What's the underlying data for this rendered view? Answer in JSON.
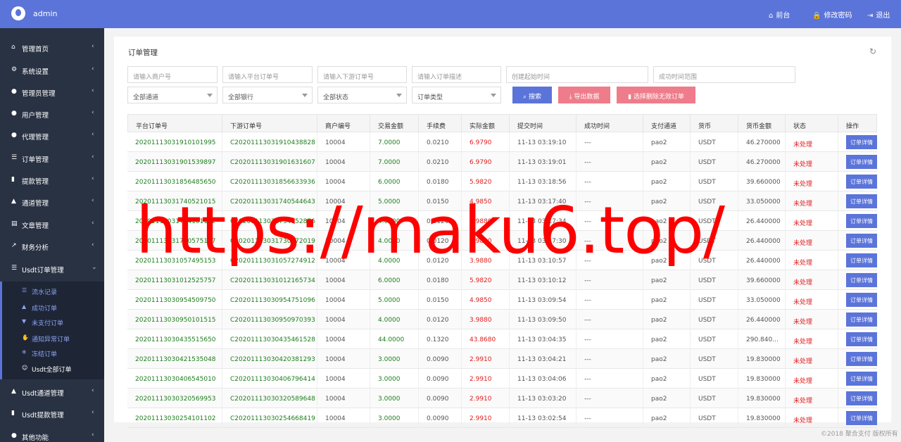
{
  "header": {
    "username": "admin",
    "links": [
      {
        "icon": "home-icon",
        "label": "前台"
      },
      {
        "icon": "lock-icon",
        "label": "修改密码"
      },
      {
        "icon": "logout-icon",
        "label": "退出"
      }
    ]
  },
  "sidebar": {
    "items": [
      {
        "icon": "home-icon",
        "label": "管理首页"
      },
      {
        "icon": "gears-icon",
        "label": "系统设置"
      },
      {
        "icon": "user-circle-icon",
        "label": "管理员管理"
      },
      {
        "icon": "users-icon",
        "label": "用户管理"
      },
      {
        "icon": "user-circle-icon",
        "label": "代理管理"
      },
      {
        "icon": "list-icon",
        "label": "订单管理"
      },
      {
        "icon": "lock-icon",
        "label": "提款管理"
      },
      {
        "icon": "bank-icon",
        "label": "通道管理"
      },
      {
        "icon": "file-icon",
        "label": "文章管理"
      },
      {
        "icon": "chart-icon",
        "label": "财务分析"
      },
      {
        "icon": "list-icon",
        "label": "Usdt订单管理"
      },
      {
        "icon": "bank-icon",
        "label": "Usdt通道管理"
      },
      {
        "icon": "lock-icon",
        "label": "Usdt提款管理"
      },
      {
        "icon": "user-circle-icon",
        "label": "其他功能"
      }
    ],
    "subitems": [
      {
        "icon": "list-icon",
        "label": "流水记录"
      },
      {
        "icon": "thumbs-up-icon",
        "label": "成功订单"
      },
      {
        "icon": "thumbs-down-icon",
        "label": "未支付订单"
      },
      {
        "icon": "hand-icon",
        "label": "通知异常订单"
      },
      {
        "icon": "snowflake-icon",
        "label": "冻结订单"
      },
      {
        "icon": "smile-icon",
        "label": "Usdt全部订单"
      }
    ]
  },
  "page": {
    "title": "订单管理",
    "filters": {
      "merchant_no": "请输入商户号",
      "platform_order": "请输入平台订单号",
      "downstream_order": "请输入下游订单号",
      "order_desc": "请输入订单描述",
      "create_time": "创建起始时间",
      "success_time": "成功时间范围",
      "channel": "全部通道",
      "bank": "全部银行",
      "status": "全部状态",
      "order_type": "订单类型"
    },
    "buttons": {
      "search": "搜索",
      "export": "导出数据",
      "delete_invalid": "选择删除无效订单"
    }
  },
  "table": {
    "headers": [
      "平台订单号",
      "下游订单号",
      "商户编号",
      "交易金额",
      "手续费",
      "实际金额",
      "提交时间",
      "成功时间",
      "支付通道",
      "货币",
      "货币金额",
      "状态",
      "操作"
    ],
    "op_label": "订单详情",
    "rows": [
      [
        "20201113031910101995",
        "C20201113031910438828",
        "10004",
        "7.0000",
        "0.0210",
        "6.9790",
        "11-13 03:19:10",
        "---",
        "pao2",
        "USDT",
        "46.270000",
        "未处理"
      ],
      [
        "20201113031901539897",
        "C20201113031901631607",
        "10004",
        "7.0000",
        "0.0210",
        "6.9790",
        "11-13 03:19:01",
        "---",
        "pao2",
        "USDT",
        "46.270000",
        "未处理"
      ],
      [
        "20201113031856485650",
        "C20201113031856633936",
        "10004",
        "6.0000",
        "0.0180",
        "5.9820",
        "11-13 03:18:56",
        "---",
        "pao2",
        "USDT",
        "39.660000",
        "未处理"
      ],
      [
        "20201113031740521015",
        "C20201113031740544643",
        "10004",
        "5.0000",
        "0.0150",
        "4.9850",
        "11-13 03:17:40",
        "---",
        "pao2",
        "USDT",
        "33.050000",
        "未处理"
      ],
      [
        "20201113031734101102",
        "C20201113031734752876",
        "10004",
        "4.0000",
        "0.0120",
        "3.9880",
        "11-13 03:17:34",
        "---",
        "pao2",
        "USDT",
        "26.440000",
        "未处理"
      ],
      [
        "20201113031730575157",
        "C20201113031730272019",
        "10004",
        "4.0000",
        "0.0120",
        "3.9880",
        "11-13 03:17:30",
        "---",
        "pao2",
        "USDT",
        "26.440000",
        "未处理"
      ],
      [
        "20201113031057495153",
        "C20201113031057274912",
        "10004",
        "4.0000",
        "0.0120",
        "3.9880",
        "11-13 03:10:57",
        "---",
        "pao2",
        "USDT",
        "26.440000",
        "未处理"
      ],
      [
        "20201113031012525757",
        "C20201113031012165734",
        "10004",
        "6.0000",
        "0.0180",
        "5.9820",
        "11-13 03:10:12",
        "---",
        "pao2",
        "USDT",
        "39.660000",
        "未处理"
      ],
      [
        "20201113030954509750",
        "C20201113030954751096",
        "10004",
        "5.0000",
        "0.0150",
        "4.9850",
        "11-13 03:09:54",
        "---",
        "pao2",
        "USDT",
        "33.050000",
        "未处理"
      ],
      [
        "20201113030950101515",
        "C20201113030950970393",
        "10004",
        "4.0000",
        "0.0120",
        "3.9880",
        "11-13 03:09:50",
        "---",
        "pao2",
        "USDT",
        "26.440000",
        "未处理"
      ],
      [
        "20201113030435515650",
        "C20201113030435461528",
        "10004",
        "44.0000",
        "0.1320",
        "43.8680",
        "11-13 03:04:35",
        "---",
        "pao2",
        "USDT",
        "290.840...",
        "未处理"
      ],
      [
        "20201113030421535048",
        "C20201113030420381293",
        "10004",
        "3.0000",
        "0.0090",
        "2.9910",
        "11-13 03:04:21",
        "---",
        "pao2",
        "USDT",
        "19.830000",
        "未处理"
      ],
      [
        "20201113030406545010",
        "C20201113030406796414",
        "10004",
        "3.0000",
        "0.0090",
        "2.9910",
        "11-13 03:04:06",
        "---",
        "pao2",
        "USDT",
        "19.830000",
        "未处理"
      ],
      [
        "20201113030320569953",
        "C20201113030320589648",
        "10004",
        "3.0000",
        "0.0090",
        "2.9910",
        "11-13 03:03:20",
        "---",
        "pao2",
        "USDT",
        "19.830000",
        "未处理"
      ],
      [
        "20201113030254101102",
        "C20201113030254668419",
        "10004",
        "3.0000",
        "0.0090",
        "2.9910",
        "11-13 03:02:54",
        "---",
        "pao2",
        "USDT",
        "19.830000",
        "未处理"
      ]
    ]
  },
  "watermark": "https://maku6.top/",
  "footer": "©2018 聚合支付 版权所有"
}
